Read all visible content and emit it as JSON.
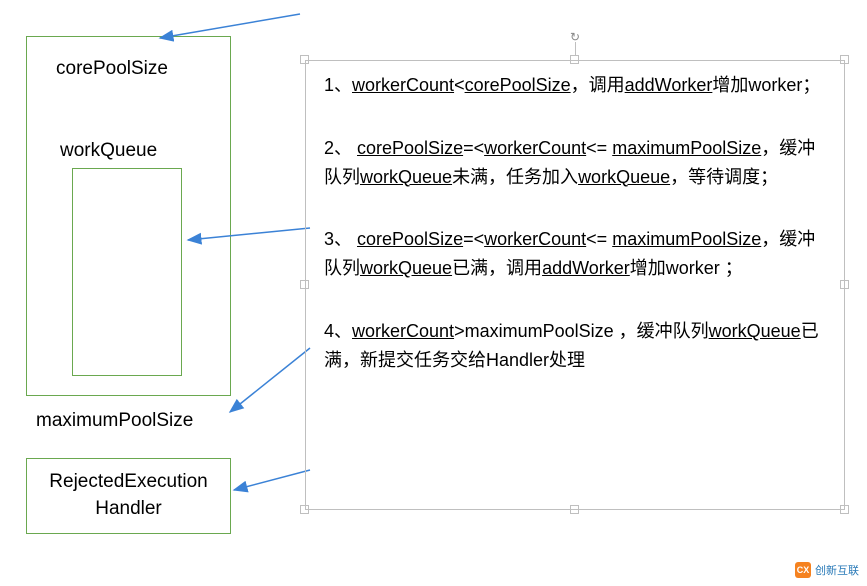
{
  "left": {
    "corePoolSize": "corePoolSize",
    "workQueue": "workQueue",
    "maximumPoolSize": "maximumPoolSize",
    "rejectedHandler_line1": "RejectedExecution",
    "rejectedHandler_line2": "Handler"
  },
  "rules": {
    "r1_prefix": "1、",
    "r1_a": "workerCount",
    "r1_lt": "<",
    "r1_b": "corePoolSize",
    "r1_mid": "，调用",
    "r1_c": "addWorker",
    "r1_tail": "增加worker；",
    "r2_prefix": "2、 ",
    "r2_a": "corePoolSize",
    "r2_range": "=<",
    "r2_b": "workerCount",
    "r2_range2": "<=",
    "r2_sp": " ",
    "r2_c": "maximumPoolSize",
    "r2_mid1": "，缓冲队列",
    "r2_q": "workQueue",
    "r2_mid2": "未满，任务加入",
    "r2_q2": "workQueue",
    "r2_tail": "，等待调度；",
    "r3_prefix": "3、 ",
    "r3_a": "corePoolSize",
    "r3_range": "=<",
    "r3_b": "workerCount",
    "r3_range2": "<=",
    "r3_sp": " ",
    "r3_c": "maximumPoolSize",
    "r3_mid1": "，缓冲队列",
    "r3_q": "workQueue",
    "r3_mid2": "已满，调用",
    "r3_add": "addWorker",
    "r3_tail": "增加worker ；",
    "r4_prefix": "4、",
    "r4_a": "workerCount",
    "r4_gt": ">",
    "r4_b": "maximumPoolSize",
    "r4_mid1": " ，缓冲队列",
    "r4_q": "workQueue",
    "r4_tail": "已满，新提交任务交给Handler处理"
  },
  "watermark": {
    "icon": "CX",
    "text": "创新互联"
  },
  "colors": {
    "boxBorder": "#6aa84f",
    "textBoxBorder": "#bfbfbf",
    "arrow": "#3b82d6"
  }
}
